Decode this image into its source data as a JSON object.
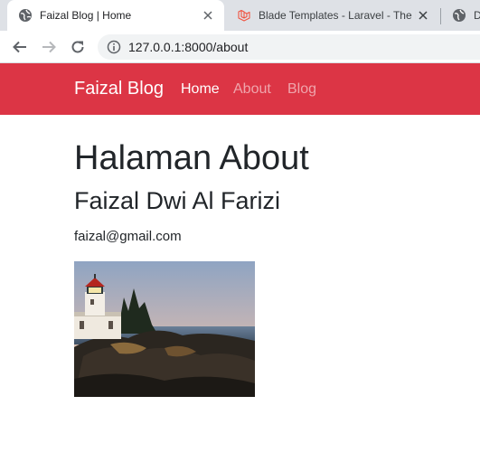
{
  "browser": {
    "tabs": [
      {
        "title": "Faizal Blog | Home",
        "icon": "globe-icon"
      },
      {
        "title": "Blade Templates - Laravel - The P",
        "icon": "laravel-icon"
      },
      {
        "title": "D",
        "icon": "globe-icon"
      }
    ],
    "url": "127.0.0.1:8000/about"
  },
  "navbar": {
    "brand": "Faizal Blog",
    "links": [
      "Home",
      "About",
      "Blog"
    ],
    "color": "#dc3545"
  },
  "content": {
    "title": "Halaman About",
    "name": "Faizal Dwi Al Farizi",
    "email": "faizal@gmail.com",
    "image": "lighthouse photo"
  }
}
